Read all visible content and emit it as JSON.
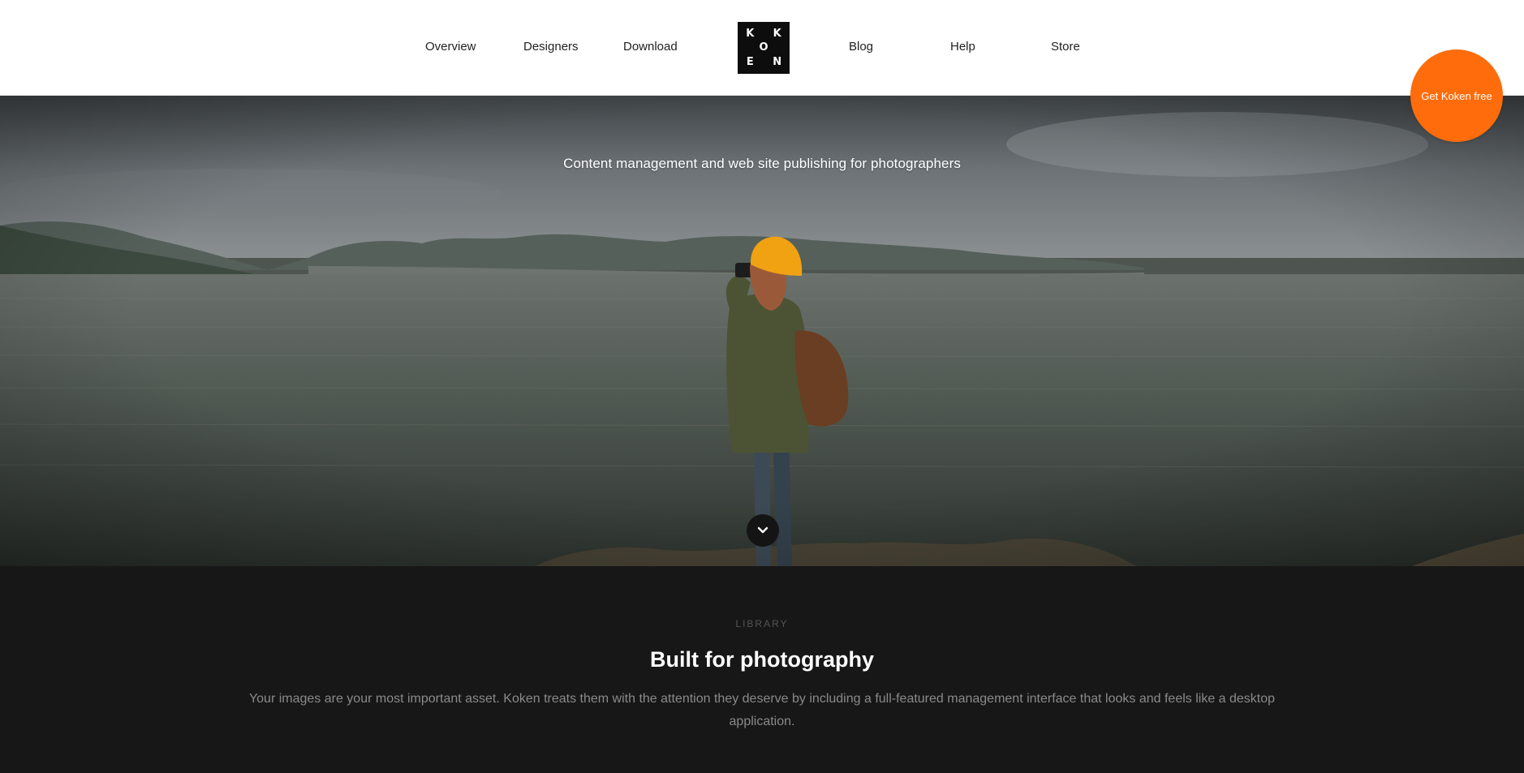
{
  "nav": {
    "items": [
      {
        "label": "Overview"
      },
      {
        "label": "Designers"
      },
      {
        "label": "Download"
      },
      {
        "label": "Blog"
      },
      {
        "label": "Help"
      },
      {
        "label": "Store"
      }
    ],
    "logo_letters": [
      "K",
      "",
      "K",
      "",
      "O",
      "",
      "E",
      "",
      "N"
    ]
  },
  "cta": {
    "label": "Get Koken free"
  },
  "hero": {
    "tagline": "Content management and web site publishing for photographers",
    "scroll_icon": "chevron-down-icon"
  },
  "library": {
    "eyebrow": "LIBRARY",
    "title": "Built for photography",
    "body": "Your images are your most important asset. Koken treats them with the attention they deserve by including a full-featured management interface that looks and feels like a desktop application."
  },
  "colors": {
    "accent": "#ff6c0b",
    "header_bg": "#ffffff",
    "dark_bg": "#171717"
  }
}
